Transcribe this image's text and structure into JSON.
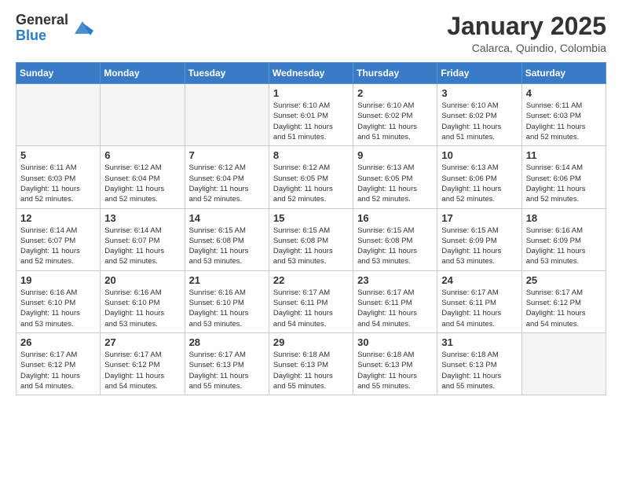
{
  "logo": {
    "general": "General",
    "blue": "Blue"
  },
  "title": "January 2025",
  "subtitle": "Calarca, Quindio, Colombia",
  "days_of_week": [
    "Sunday",
    "Monday",
    "Tuesday",
    "Wednesday",
    "Thursday",
    "Friday",
    "Saturday"
  ],
  "weeks": [
    [
      {
        "day": "",
        "info": ""
      },
      {
        "day": "",
        "info": ""
      },
      {
        "day": "",
        "info": ""
      },
      {
        "day": "1",
        "info": "Sunrise: 6:10 AM\nSunset: 6:01 PM\nDaylight: 11 hours\nand 51 minutes."
      },
      {
        "day": "2",
        "info": "Sunrise: 6:10 AM\nSunset: 6:02 PM\nDaylight: 11 hours\nand 51 minutes."
      },
      {
        "day": "3",
        "info": "Sunrise: 6:10 AM\nSunset: 6:02 PM\nDaylight: 11 hours\nand 51 minutes."
      },
      {
        "day": "4",
        "info": "Sunrise: 6:11 AM\nSunset: 6:03 PM\nDaylight: 11 hours\nand 52 minutes."
      }
    ],
    [
      {
        "day": "5",
        "info": "Sunrise: 6:11 AM\nSunset: 6:03 PM\nDaylight: 11 hours\nand 52 minutes."
      },
      {
        "day": "6",
        "info": "Sunrise: 6:12 AM\nSunset: 6:04 PM\nDaylight: 11 hours\nand 52 minutes."
      },
      {
        "day": "7",
        "info": "Sunrise: 6:12 AM\nSunset: 6:04 PM\nDaylight: 11 hours\nand 52 minutes."
      },
      {
        "day": "8",
        "info": "Sunrise: 6:12 AM\nSunset: 6:05 PM\nDaylight: 11 hours\nand 52 minutes."
      },
      {
        "day": "9",
        "info": "Sunrise: 6:13 AM\nSunset: 6:05 PM\nDaylight: 11 hours\nand 52 minutes."
      },
      {
        "day": "10",
        "info": "Sunrise: 6:13 AM\nSunset: 6:06 PM\nDaylight: 11 hours\nand 52 minutes."
      },
      {
        "day": "11",
        "info": "Sunrise: 6:14 AM\nSunset: 6:06 PM\nDaylight: 11 hours\nand 52 minutes."
      }
    ],
    [
      {
        "day": "12",
        "info": "Sunrise: 6:14 AM\nSunset: 6:07 PM\nDaylight: 11 hours\nand 52 minutes."
      },
      {
        "day": "13",
        "info": "Sunrise: 6:14 AM\nSunset: 6:07 PM\nDaylight: 11 hours\nand 52 minutes."
      },
      {
        "day": "14",
        "info": "Sunrise: 6:15 AM\nSunset: 6:08 PM\nDaylight: 11 hours\nand 53 minutes."
      },
      {
        "day": "15",
        "info": "Sunrise: 6:15 AM\nSunset: 6:08 PM\nDaylight: 11 hours\nand 53 minutes."
      },
      {
        "day": "16",
        "info": "Sunrise: 6:15 AM\nSunset: 6:08 PM\nDaylight: 11 hours\nand 53 minutes."
      },
      {
        "day": "17",
        "info": "Sunrise: 6:15 AM\nSunset: 6:09 PM\nDaylight: 11 hours\nand 53 minutes."
      },
      {
        "day": "18",
        "info": "Sunrise: 6:16 AM\nSunset: 6:09 PM\nDaylight: 11 hours\nand 53 minutes."
      }
    ],
    [
      {
        "day": "19",
        "info": "Sunrise: 6:16 AM\nSunset: 6:10 PM\nDaylight: 11 hours\nand 53 minutes."
      },
      {
        "day": "20",
        "info": "Sunrise: 6:16 AM\nSunset: 6:10 PM\nDaylight: 11 hours\nand 53 minutes."
      },
      {
        "day": "21",
        "info": "Sunrise: 6:16 AM\nSunset: 6:10 PM\nDaylight: 11 hours\nand 53 minutes."
      },
      {
        "day": "22",
        "info": "Sunrise: 6:17 AM\nSunset: 6:11 PM\nDaylight: 11 hours\nand 54 minutes."
      },
      {
        "day": "23",
        "info": "Sunrise: 6:17 AM\nSunset: 6:11 PM\nDaylight: 11 hours\nand 54 minutes."
      },
      {
        "day": "24",
        "info": "Sunrise: 6:17 AM\nSunset: 6:11 PM\nDaylight: 11 hours\nand 54 minutes."
      },
      {
        "day": "25",
        "info": "Sunrise: 6:17 AM\nSunset: 6:12 PM\nDaylight: 11 hours\nand 54 minutes."
      }
    ],
    [
      {
        "day": "26",
        "info": "Sunrise: 6:17 AM\nSunset: 6:12 PM\nDaylight: 11 hours\nand 54 minutes."
      },
      {
        "day": "27",
        "info": "Sunrise: 6:17 AM\nSunset: 6:12 PM\nDaylight: 11 hours\nand 54 minutes."
      },
      {
        "day": "28",
        "info": "Sunrise: 6:17 AM\nSunset: 6:13 PM\nDaylight: 11 hours\nand 55 minutes."
      },
      {
        "day": "29",
        "info": "Sunrise: 6:18 AM\nSunset: 6:13 PM\nDaylight: 11 hours\nand 55 minutes."
      },
      {
        "day": "30",
        "info": "Sunrise: 6:18 AM\nSunset: 6:13 PM\nDaylight: 11 hours\nand 55 minutes."
      },
      {
        "day": "31",
        "info": "Sunrise: 6:18 AM\nSunset: 6:13 PM\nDaylight: 11 hours\nand 55 minutes."
      },
      {
        "day": "",
        "info": ""
      }
    ]
  ]
}
